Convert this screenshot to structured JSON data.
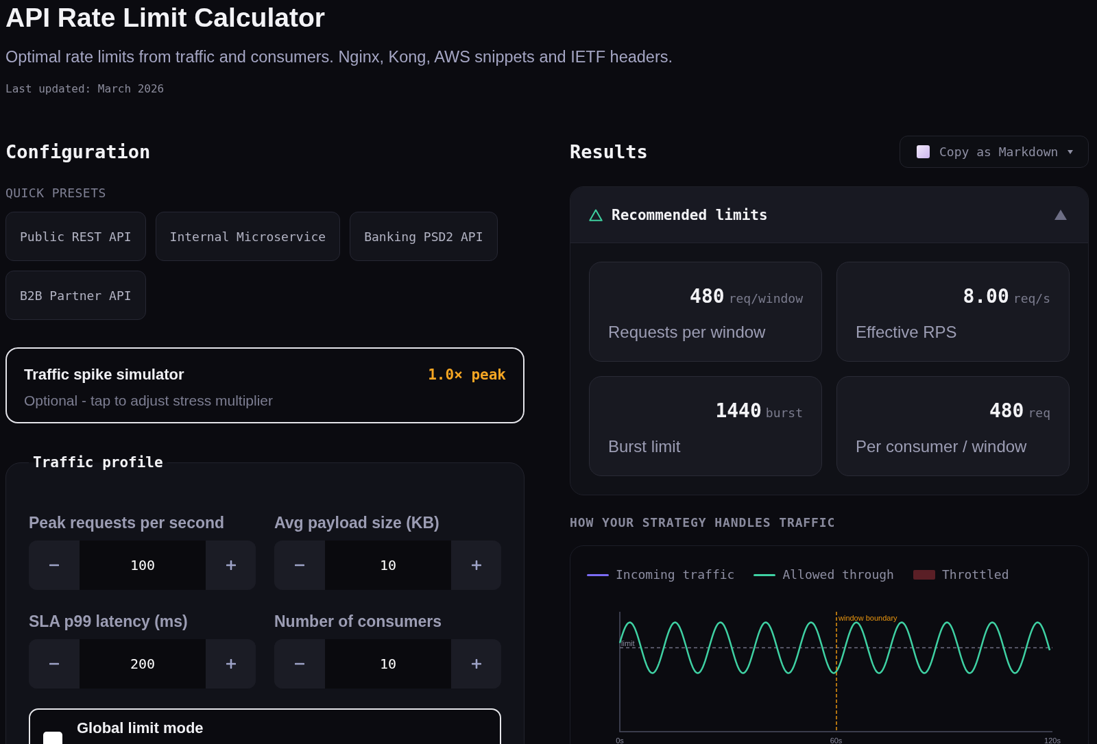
{
  "header": {
    "title": "API Rate Limit Calculator",
    "subtitle": "Optimal rate limits from traffic and consumers. Nginx, Kong, AWS snippets and IETF headers.",
    "updated": "Last updated: March 2026"
  },
  "configuration": {
    "heading": "Configuration",
    "presets_label": "QUICK PRESETS",
    "presets": [
      "Public REST API",
      "Internal Microservice",
      "Banking PSD2 API",
      "B2B Partner API"
    ],
    "spike_simulator": {
      "title": "Traffic spike simulator",
      "multiplier": "1.0× peak",
      "hint": "Optional - tap to adjust stress multiplier"
    },
    "traffic_profile": {
      "legend": "Traffic profile",
      "fields": [
        {
          "label": "Peak requests per second",
          "value": "100"
        },
        {
          "label": "Avg payload size (KB)",
          "value": "10"
        },
        {
          "label": "SLA p99 latency (ms)",
          "value": "200"
        },
        {
          "label": "Number of consumers",
          "value": "10"
        }
      ],
      "global_limit": {
        "label": "Global limit mode",
        "checked": false
      }
    }
  },
  "results": {
    "heading": "Results",
    "copy_button": "Copy as Markdown",
    "recommended": {
      "title": "Recommended limits",
      "expanded": true,
      "metrics": [
        {
          "value": "480",
          "unit": "req/window",
          "label": "Requests per window"
        },
        {
          "value": "8.00",
          "unit": "req/s",
          "label": "Effective RPS"
        },
        {
          "value": "1440",
          "unit": "burst",
          "label": "Burst limit"
        },
        {
          "value": "480",
          "unit": "req",
          "label": "Per consumer / window"
        }
      ]
    },
    "chart": {
      "heading": "HOW YOUR STRATEGY HANDLES TRAFFIC",
      "legend": [
        {
          "label": "Incoming traffic",
          "color": "#7c6cf5",
          "kind": "line"
        },
        {
          "label": "Allowed through",
          "color": "#3fd1a3",
          "kind": "line"
        },
        {
          "label": "Throttled",
          "color": "#5a1f26",
          "kind": "block"
        }
      ],
      "limit_label": "limit",
      "boundary_label": "window boundary",
      "x_tick_labels": [
        "0s",
        "60s",
        "120s"
      ]
    }
  }
}
